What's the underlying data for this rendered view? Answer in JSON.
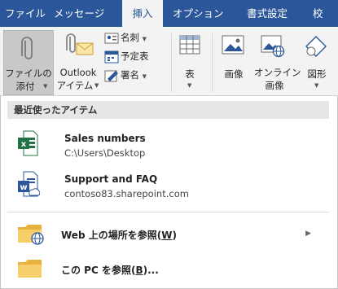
{
  "ribbon_tabs": [
    "ファイル",
    "メッセージ",
    "挿入",
    "オプション",
    "書式設定",
    "校"
  ],
  "active_tab": "挿入",
  "ribbon": {
    "attach_file": [
      "ファイルの",
      "添付"
    ],
    "outlook_item": [
      "Outlook",
      "アイテム"
    ],
    "business_card": "名刺",
    "calendar": "予定表",
    "signature": "署名",
    "table": "表",
    "pictures": "画像",
    "online_pictures": [
      "オンライン",
      "画像"
    ],
    "shapes": "図形"
  },
  "dropdown": {
    "section_title": "最近使ったアイテム",
    "recent_items": [
      {
        "title": "Sales numbers",
        "subtitle": "C:\\Users\\Desktop",
        "icon": "excel-file-icon"
      },
      {
        "title": "Support and FAQ",
        "subtitle": "contoso83.sharepoint.com",
        "icon": "word-cloud-file-icon"
      }
    ],
    "browse_web": {
      "label": "Web 上の場所を参照(",
      "key": "W",
      "suffix": ")"
    },
    "browse_pc": {
      "label": "この PC を参照(",
      "key": "B",
      "suffix": ")..."
    }
  },
  "colors": {
    "accent": "#2b579a",
    "excel": "#217346",
    "word": "#2b579a",
    "folder": "#f2c24c"
  }
}
